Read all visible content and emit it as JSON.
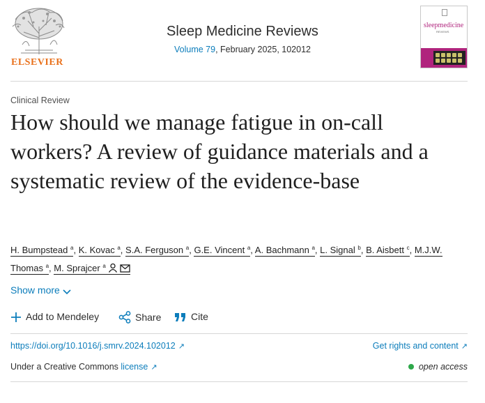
{
  "publisher": {
    "name": "ELSEVIER",
    "icon": "elsevier-tree-logo"
  },
  "journal": {
    "name": "Sleep Medicine Reviews",
    "volume_link": "Volume 79",
    "volume_rest": ", February 2025, 102012",
    "cover_title": "sleepmedicine",
    "cover_subtitle": "REVIEWS"
  },
  "article": {
    "section": "Clinical Review",
    "title": "How should we manage fatigue in on-call workers? A review of guidance materials and a systematic review of the evidence-base"
  },
  "authors": [
    {
      "name": "H. Bumpstead",
      "aff": "a",
      "sep": ", "
    },
    {
      "name": "K. Kovac",
      "aff": "a",
      "sep": ", "
    },
    {
      "name": "S.A. Ferguson",
      "aff": "a",
      "sep": ", "
    },
    {
      "name": "G.E. Vincent",
      "aff": "a",
      "sep": ", "
    },
    {
      "name": "A. Bachmann",
      "aff": "a",
      "sep": ", "
    },
    {
      "name": "L. Signal",
      "aff": "b",
      "sep": ", "
    },
    {
      "name": "B. Aisbett",
      "aff": "c",
      "sep": ", "
    },
    {
      "name": "M.J.W. Thomas",
      "aff": "a",
      "sep": ", "
    },
    {
      "name": "M. Sprajcer",
      "aff": "a",
      "sep": ""
    }
  ],
  "actions": {
    "show_more": "Show more",
    "mendeley": "Add to Mendeley",
    "share": "Share",
    "cite": "Cite"
  },
  "links": {
    "doi": "https://doi.org/10.1016/j.smrv.2024.102012",
    "rights": "Get rights and content",
    "license_prefix": "Under a Creative Commons ",
    "license_link": "license",
    "open_access": "open access"
  },
  "colors": {
    "link": "#0c7dbb",
    "elsevier_orange": "#e9711c",
    "open_access_dot": "#2ea84a",
    "cover_accent": "#b0247d"
  }
}
